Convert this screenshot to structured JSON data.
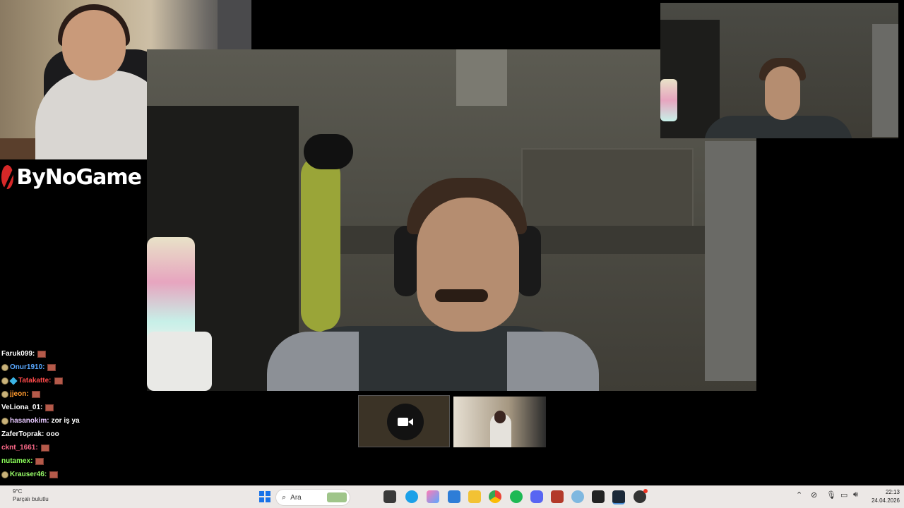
{
  "brand": {
    "logo_text": "ByNoGame"
  },
  "chat": {
    "messages": [
      {
        "user": "Faruk099:",
        "color": "#ffffff",
        "badges": 0,
        "text": "",
        "emote": true
      },
      {
        "user": "Onur1910:",
        "color": "#5aa8ff",
        "badges": 1,
        "text": "",
        "emote": true
      },
      {
        "user": "Tatakatte:",
        "color": "#ff4a4a",
        "badges": 2,
        "text": "",
        "emote": true
      },
      {
        "user": "jjeon:",
        "color": "#ff9a2e",
        "badges": 1,
        "text": "",
        "emote": true
      },
      {
        "user": "VeLiona_01:",
        "color": "#ffffff",
        "badges": 0,
        "text": "",
        "emote": true
      },
      {
        "user": "hasanokim:",
        "color": "#e6c8ff",
        "badges": 1,
        "text": "zor iş ya",
        "emote": false
      },
      {
        "user": "ZaferToprak:",
        "color": "#ffffff",
        "badges": 0,
        "text": "ooo",
        "emote": false
      },
      {
        "user": "cknt_1661:",
        "color": "#ff6a8a",
        "badges": 0,
        "text": "",
        "emote": true
      },
      {
        "user": "nutamex:",
        "color": "#8cff5a",
        "badges": 0,
        "text": "",
        "emote": true
      },
      {
        "user": "Krauser46:",
        "color": "#9aff6a",
        "badges": 1,
        "text": "",
        "emote": true
      }
    ]
  },
  "taskbar": {
    "weather_temp": "9°C",
    "weather_desc": "Parçalı bulutlu",
    "search_placeholder": "Ara",
    "time": "22:13",
    "date": "24.04.2026"
  },
  "icons": [
    "windows-start-icon",
    "search-icon",
    "file-explorer-icon",
    "edge-icon",
    "copilot-icon",
    "store-icon",
    "folder-icon",
    "chrome-icon",
    "spotify-icon",
    "discord-icon",
    "app-icon",
    "settings-icon",
    "epic-games-icon",
    "steam-icon",
    "app-red-icon"
  ]
}
